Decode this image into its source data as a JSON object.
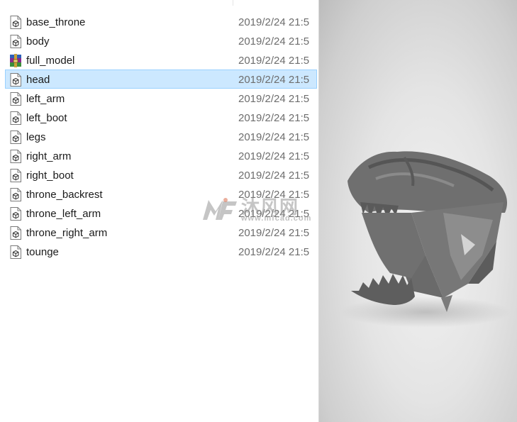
{
  "files": [
    {
      "name": "base_throne",
      "date": "2019/2/24 21:5",
      "icon": "model-file-icon",
      "selected": false
    },
    {
      "name": "body",
      "date": "2019/2/24 21:5",
      "icon": "model-file-icon",
      "selected": false
    },
    {
      "name": "full_model",
      "date": "2019/2/24 21:5",
      "icon": "archive-icon",
      "selected": false
    },
    {
      "name": "head",
      "date": "2019/2/24 21:5",
      "icon": "model-file-icon",
      "selected": true
    },
    {
      "name": "left_arm",
      "date": "2019/2/24 21:5",
      "icon": "model-file-icon",
      "selected": false
    },
    {
      "name": "left_boot",
      "date": "2019/2/24 21:5",
      "icon": "model-file-icon",
      "selected": false
    },
    {
      "name": "legs",
      "date": "2019/2/24 21:5",
      "icon": "model-file-icon",
      "selected": false
    },
    {
      "name": "right_arm",
      "date": "2019/2/24 21:5",
      "icon": "model-file-icon",
      "selected": false
    },
    {
      "name": "right_boot",
      "date": "2019/2/24 21:5",
      "icon": "model-file-icon",
      "selected": false
    },
    {
      "name": "throne_backrest",
      "date": "2019/2/24 21:5",
      "icon": "model-file-icon",
      "selected": false
    },
    {
      "name": "throne_left_arm",
      "date": "2019/2/24 21:5",
      "icon": "model-file-icon",
      "selected": false
    },
    {
      "name": "throne_right_arm",
      "date": "2019/2/24 21:5",
      "icon": "model-file-icon",
      "selected": false
    },
    {
      "name": "tounge",
      "date": "2019/2/24 21:5",
      "icon": "model-file-icon",
      "selected": false
    }
  ],
  "preview": {
    "icon": "3d-head-model-preview"
  },
  "watermark": {
    "brand": "沐风网",
    "url": "www.mfcad.com"
  },
  "colors": {
    "selection_bg": "#cce8ff",
    "selection_border": "#99d1ff",
    "date_text": "#6d6d6d"
  }
}
